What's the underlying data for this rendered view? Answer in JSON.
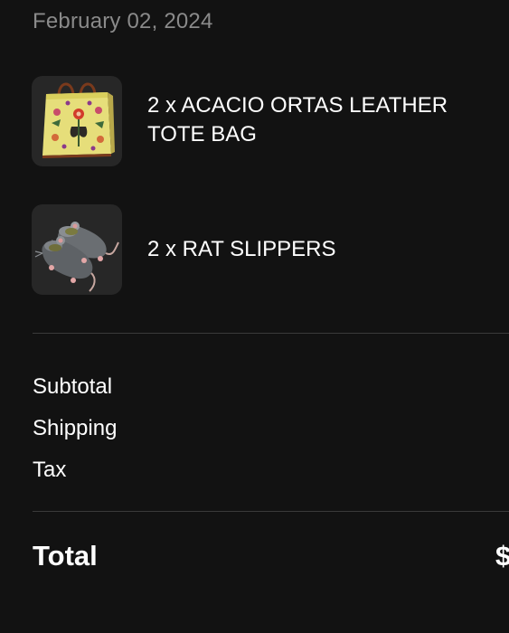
{
  "order": {
    "date": "February 02, 2024"
  },
  "items": [
    {
      "label": "2 x ACACIO ORTAS LEATHER TOTE BAG",
      "image_icon": "tote-bag-image"
    },
    {
      "label": "2 x RAT SLIPPERS",
      "image_icon": "rat-slippers-image"
    }
  ],
  "summary": {
    "subtotal_label": "Subtotal",
    "shipping_label": "Shipping",
    "tax_label": "Tax"
  },
  "total": {
    "label": "Total",
    "value": "$"
  },
  "colors": {
    "background": "#121212",
    "thumb_background": "#272727",
    "date_text": "#8a8a8a",
    "divider": "#3a3a3a"
  }
}
